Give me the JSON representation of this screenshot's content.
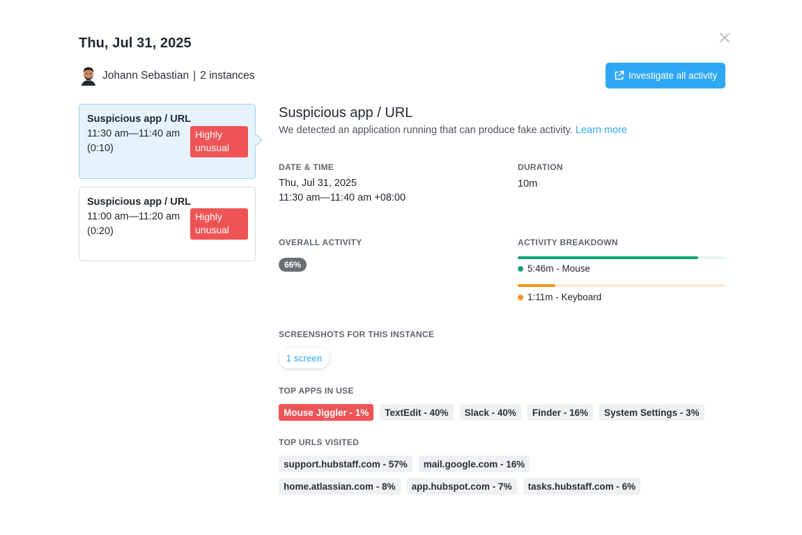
{
  "header": {
    "date": "Thu, Jul 31, 2025",
    "user_name": "Johann Sebastian",
    "separator": "|",
    "instances": "2 instances",
    "investigate_label": "Investigate all activity"
  },
  "instances_list": [
    {
      "title": "Suspicious app / URL",
      "time": "11:30 am—11:40 am",
      "duration": "(0:10)",
      "badge": "Highly unusual",
      "active": true
    },
    {
      "title": "Suspicious app / URL",
      "time": "11:00 am—11:20 am",
      "duration": "(0:20)",
      "badge": "Highly unusual",
      "active": false
    }
  ],
  "detail": {
    "title": "Suspicious app / URL",
    "description": "We detected an application running that can produce fake activity.",
    "learn_more": "Learn more",
    "date_time_label": "DATE & TIME",
    "date": "Thu, Jul 31, 2025",
    "time_range": "11:30 am—11:40 am +08:00",
    "duration_label": "DURATION",
    "duration": "10m",
    "overall_label": "OVERALL ACTIVITY",
    "overall_value": "66%",
    "breakdown_label": "ACTIVITY BREAKDOWN",
    "breakdown": [
      {
        "label": "5:46m - Mouse",
        "fraction": 0.87,
        "color": "#14a374",
        "track": "#e3f6f0"
      },
      {
        "label": "1:11m - Keyboard",
        "fraction": 0.18,
        "color": "#f7931e",
        "track": "#fde8d6"
      }
    ],
    "screenshots_label": "SCREENSHOTS FOR THIS INSTANCE",
    "screenshots_value": "1 screen",
    "top_apps_label": "TOP APPS IN USE",
    "top_apps": [
      {
        "label": "Mouse Jiggler - 1%",
        "danger": true
      },
      {
        "label": "TextEdit - 40%",
        "danger": false
      },
      {
        "label": "Slack - 40%",
        "danger": false
      },
      {
        "label": "Finder - 16%",
        "danger": false
      },
      {
        "label": "System Settings - 3%",
        "danger": false
      }
    ],
    "top_urls_label": "TOP URLS VISITED",
    "top_urls": [
      "support.hubstaff.com - 57%",
      "mail.google.com - 16%",
      "home.atlassian.com - 8%",
      "app.hubspot.com - 7%",
      "tasks.hubstaff.com - 6%"
    ]
  },
  "colors": {
    "accent": "#2ea8f5",
    "danger": "#ef5455",
    "active_card": "#e6f3fc"
  },
  "icons": [
    "close-icon",
    "external-link-icon",
    "avatar"
  ]
}
